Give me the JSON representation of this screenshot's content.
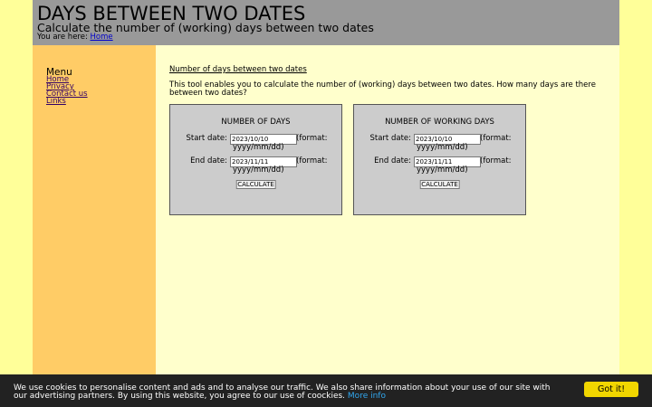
{
  "header": {
    "title": "DAYS BETWEEN TWO DATES",
    "subtitle": "Calculate the number of (working) days between two dates",
    "breadcrumb_prefix": "You are here:",
    "breadcrumb_link": "Home"
  },
  "sidebar": {
    "menu_title": "Menu",
    "items": [
      {
        "label": "Home"
      },
      {
        "label": "Privacy"
      },
      {
        "label": "Contact us"
      },
      {
        "label": "Links"
      }
    ]
  },
  "content": {
    "heading": "Number of days between two dates",
    "intro": "This tool enables you to calculate the number of (working) days between two dates. How many days are there between two dates?"
  },
  "tools": [
    {
      "title": "NUMBER OF DAYS",
      "start_label": "Start date:",
      "start_value": "2023/10/10",
      "end_label": "End date:",
      "end_value": "2023/11/11",
      "format_a": "(format:",
      "format_b": "yyyy/mm/dd)",
      "button": "CALCULATE"
    },
    {
      "title": "NUMBER OF WORKING DAYS",
      "start_label": "Start date:",
      "start_value": "2023/10/10",
      "end_label": "End date:",
      "end_value": "2023/11/11",
      "format_a": "(format:",
      "format_b": "yyyy/mm/dd)",
      "button": "CALCULATE"
    }
  ],
  "cookie": {
    "text": "We use cookies to personalise content and ads and to analyse our traffic. We also share information about your use of our site with our advertising partners. By using this website, you agree to our use of coockies.",
    "more_link": "More info",
    "button": "Got it!"
  },
  "colors": {
    "outer_background": "#ffff99",
    "header_background": "#999999",
    "sidebar_background": "#ffcc66",
    "content_background": "#ffffcc",
    "tool_background": "#cccccc",
    "cookie_background": "#222222",
    "cookie_button": "#f1d600"
  }
}
